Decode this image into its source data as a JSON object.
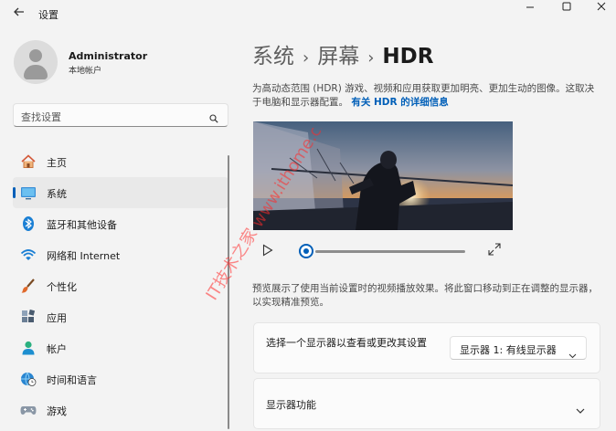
{
  "window": {
    "title": "设置",
    "back_icon": "back-arrow-icon",
    "controls": [
      "minimize-icon",
      "maximize-icon",
      "close-icon"
    ]
  },
  "account": {
    "name": "Administrator",
    "type": "本地帐户"
  },
  "search": {
    "placeholder": "查找设置"
  },
  "sidebar": {
    "items": [
      {
        "label": "主页",
        "icon": "home-icon"
      },
      {
        "label": "系统",
        "icon": "system-display-icon",
        "active": true
      },
      {
        "label": "蓝牙和其他设备",
        "icon": "bluetooth-icon"
      },
      {
        "label": "网络和 Internet",
        "icon": "wifi-icon"
      },
      {
        "label": "个性化",
        "icon": "paintbrush-icon"
      },
      {
        "label": "应用",
        "icon": "apps-icon"
      },
      {
        "label": "帐户",
        "icon": "account-icon"
      },
      {
        "label": "时间和语言",
        "icon": "globe-clock-icon"
      },
      {
        "label": "游戏",
        "icon": "gamepad-icon"
      }
    ]
  },
  "breadcrumb": {
    "items": [
      "系统",
      "屏幕"
    ],
    "current": "HDR"
  },
  "hdr": {
    "description": "为高动态范围 (HDR) 游戏、视频和应用获取更加明亮、更加生动的图像。这取决于电脑和显示器配置。",
    "link": "有关 HDR 的详细信息",
    "preview_description": "预览展示了使用当前设置时的视频播放效果。将此窗口移动到正在调整的显示器，以实现精准预览。"
  },
  "player": {
    "progress": 0.0
  },
  "display_select": {
    "label": "选择一个显示器以查看或更改其设置",
    "selected": "显示器 1: 有线显示器"
  },
  "display_features": {
    "label": "显示器功能"
  },
  "watermark": {
    "text": "IT技术之家 www.ithome.com"
  },
  "colors": {
    "accent": "#005fb8",
    "background": "#f3f3f3",
    "card": "#fbfbfb"
  }
}
